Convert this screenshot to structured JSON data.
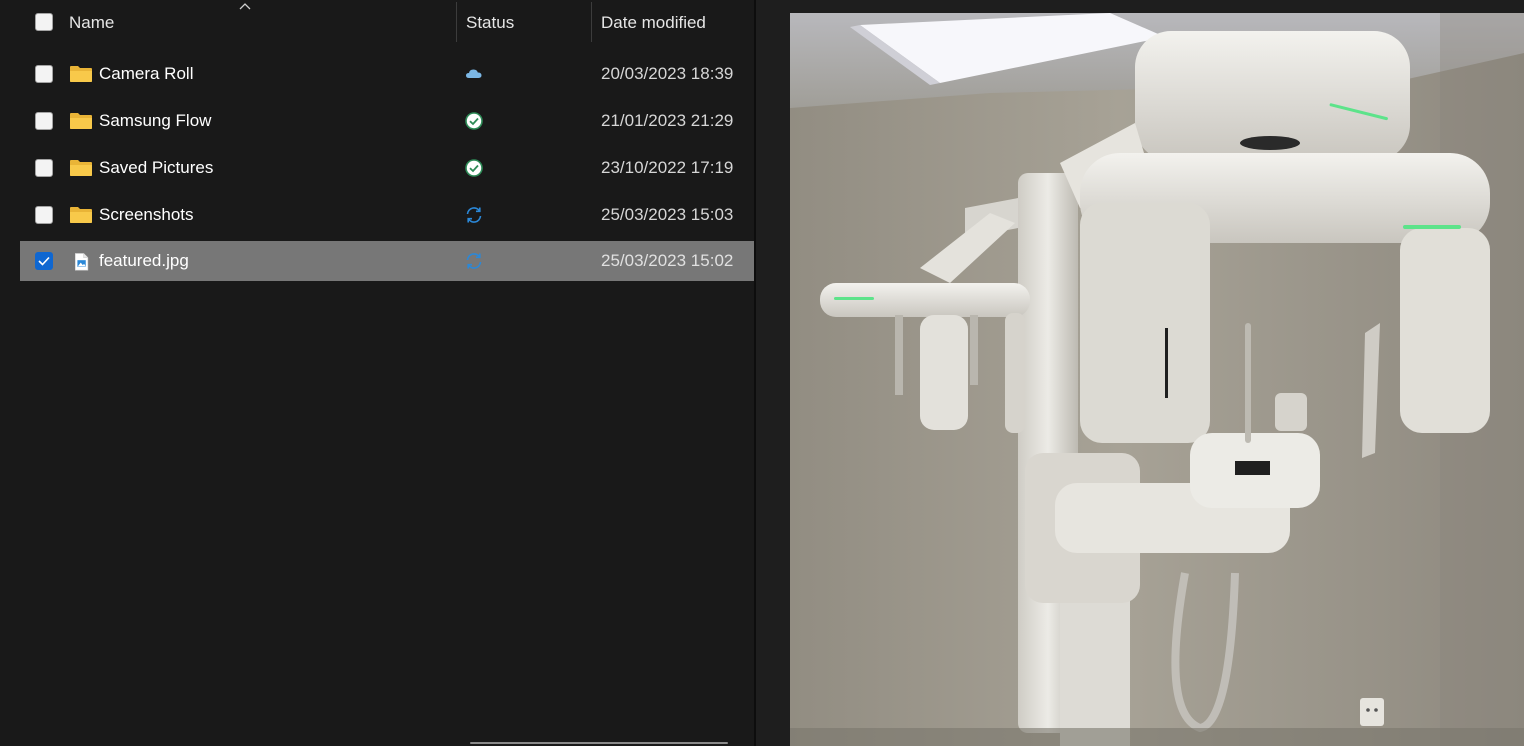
{
  "header": {
    "name_label": "Name",
    "status_label": "Status",
    "date_label": "Date modified"
  },
  "rows": [
    {
      "name": "Camera Roll",
      "type": "folder",
      "status": "cloud-icon",
      "date": "20/03/2023 18:39",
      "selected": false
    },
    {
      "name": "Samsung Flow",
      "type": "folder",
      "status": "available-check-icon",
      "date": "21/01/2023 21:29",
      "selected": false
    },
    {
      "name": "Saved Pictures",
      "type": "folder",
      "status": "available-check-icon",
      "date": "23/10/2022 17:19",
      "selected": false
    },
    {
      "name": "Screenshots",
      "type": "folder",
      "status": "sync-icon",
      "date": "25/03/2023 15:03",
      "selected": false
    },
    {
      "name": "featured.jpg",
      "type": "image-file",
      "status": "sync-icon",
      "date": "25/03/2023 15:02",
      "selected": true
    }
  ],
  "colors": {
    "background": "#191919",
    "selected_row": "#777777",
    "accent": "#0f67d1",
    "folder": "#f8c94a",
    "check_ok": "#2e8b57",
    "cloud": "#7cb8e6",
    "sync": "#2b88d8"
  },
  "preview": {
    "subject": "dental panoramic x-ray machine photo"
  }
}
